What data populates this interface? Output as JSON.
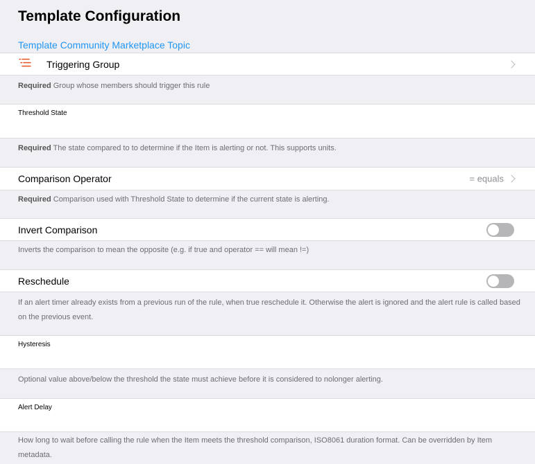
{
  "page": {
    "title": "Template Configuration",
    "marketplace_link": "Template Community Marketplace Topic"
  },
  "colors": {
    "accent": "#2196f3",
    "group_icon": "#e8501d",
    "background": "#efeff4"
  },
  "required_label": "Required",
  "fields": {
    "triggering_group": {
      "label": "Triggering Group",
      "icon": "list-icon",
      "info": "Group whose members should trigger this rule"
    },
    "threshold_state": {
      "label": "Threshold State",
      "value": "",
      "info": "The state compared to to determine if the Item is alerting or not. This supports units."
    },
    "comparison_operator": {
      "label": "Comparison Operator",
      "value": "= equals",
      "info": "Comparison used with Threshold State to determine if the current state is alerting."
    },
    "invert_comparison": {
      "label": "Invert Comparison",
      "checked": false,
      "info": "Inverts the comparison to mean the opposite (e.g. if true and operator == will mean !=)"
    },
    "reschedule": {
      "label": "Reschedule",
      "checked": false,
      "info": "If an alert timer already exists from a previous run of the rule, when true reschedule it. Otherwise the alert is ignored and the alert rule is called based on the previous event."
    },
    "hysteresis": {
      "label": "Hysteresis",
      "value": "",
      "info": "Optional value above/below the threshold the state must achieve before it is considered to nolonger alerting."
    },
    "alert_delay": {
      "label": "Alert Delay",
      "value": "",
      "info": "How long to wait before calling the rule when the Item meets the threshold comparison, ISO8061 duration format. Can be overridden by Item metadata."
    }
  }
}
